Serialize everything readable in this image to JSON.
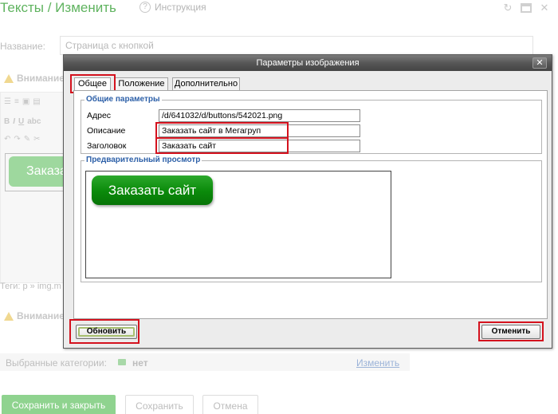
{
  "background": {
    "title": "Тексты / Изменить",
    "help_label": "Инструкция",
    "name_label": "Название:",
    "name_value": "Страница с кнопкой",
    "warning_label_1": "Внимание",
    "warning_label_2": "Внимание",
    "preview_button_text": "Заказать",
    "tags_label": "Теги: p » img.m",
    "categories_label": "Выбранные категории:",
    "categories_value": "нет",
    "categories_edit_link": "Изменить",
    "save_close_button": "Сохранить и закрыть",
    "save_button": "Сохранить",
    "cancel_button": "Отмена"
  },
  "dialog": {
    "title": "Параметры изображения",
    "close_glyph": "✕",
    "tabs": [
      {
        "label": "Общее",
        "active": true
      },
      {
        "label": "Положение",
        "active": false
      },
      {
        "label": "Дополнительно",
        "active": false
      }
    ],
    "general": {
      "legend": "Общие параметры",
      "fields": [
        {
          "label": "Адрес",
          "value": "/d/641032/d/buttons/542021.png"
        },
        {
          "label": "Описание",
          "value": "Заказать сайт в Мегагруп"
        },
        {
          "label": "Заголовок",
          "value": "Заказать сайт"
        }
      ]
    },
    "preview": {
      "legend": "Предварительный просмотр",
      "button_text": "Заказать сайт"
    },
    "refresh_button": "Обновить",
    "cancel_button": "Отменить"
  },
  "colors": {
    "highlight": "#d4121e",
    "brand_green": "#5fb35f",
    "legend_blue": "#2d60a8"
  }
}
